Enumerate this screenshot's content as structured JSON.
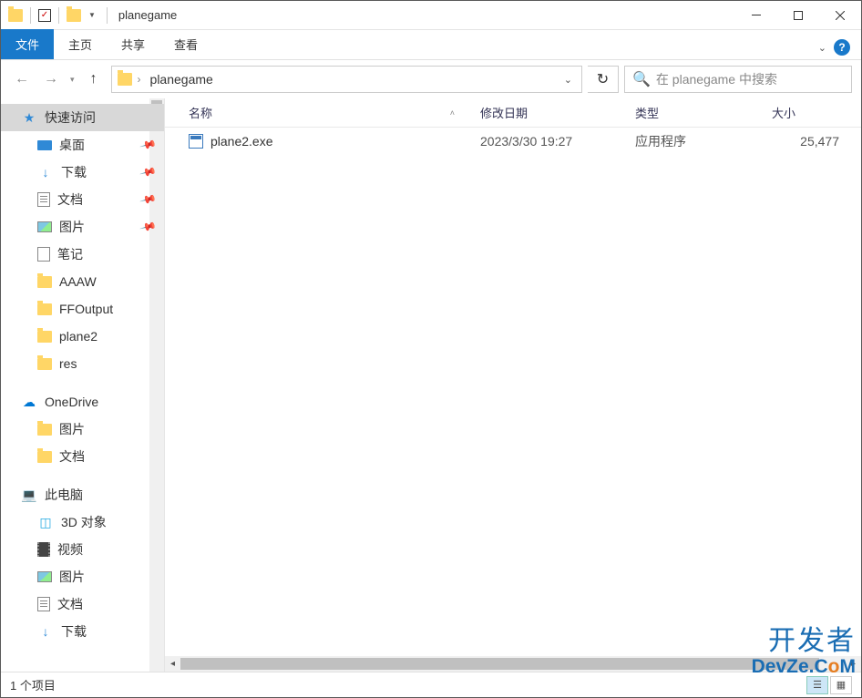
{
  "window": {
    "title": "planegame"
  },
  "ribbon": {
    "file": "文件",
    "tabs": [
      "主页",
      "共享",
      "查看"
    ]
  },
  "address": {
    "crumbs": [
      "planegame"
    ]
  },
  "search": {
    "placeholder": "在 planegame 中搜索"
  },
  "sidebar": {
    "quick_access": "快速访问",
    "quick_items": [
      {
        "label": "桌面",
        "pinned": true,
        "icon": "desktop"
      },
      {
        "label": "下载",
        "pinned": true,
        "icon": "download"
      },
      {
        "label": "文档",
        "pinned": true,
        "icon": "doc"
      },
      {
        "label": "图片",
        "pinned": true,
        "icon": "pic"
      },
      {
        "label": "笔记",
        "pinned": false,
        "icon": "note"
      },
      {
        "label": "AAAW",
        "pinned": false,
        "icon": "folder"
      },
      {
        "label": "FFOutput",
        "pinned": false,
        "icon": "folder"
      },
      {
        "label": "plane2",
        "pinned": false,
        "icon": "folder"
      },
      {
        "label": "res",
        "pinned": false,
        "icon": "folder"
      }
    ],
    "onedrive": "OneDrive",
    "onedrive_items": [
      {
        "label": "图片",
        "icon": "folder"
      },
      {
        "label": "文档",
        "icon": "folder"
      }
    ],
    "this_pc": "此电脑",
    "pc_items": [
      {
        "label": "3D 对象",
        "icon": "cube"
      },
      {
        "label": "视频",
        "icon": "video"
      },
      {
        "label": "图片",
        "icon": "pic"
      },
      {
        "label": "文档",
        "icon": "doc"
      },
      {
        "label": "下载",
        "icon": "download"
      }
    ]
  },
  "columns": {
    "name": "名称",
    "date": "修改日期",
    "type": "类型",
    "size": "大小"
  },
  "files": [
    {
      "name": "plane2.exe",
      "date": "2023/3/30 19:27",
      "type": "应用程序",
      "size": "25,477 "
    }
  ],
  "status": {
    "count": "1 个项目"
  },
  "watermark": {
    "cn": "开发者",
    "en_pre": "DevZe.C",
    "en_o": "o",
    "en_post": "M"
  }
}
